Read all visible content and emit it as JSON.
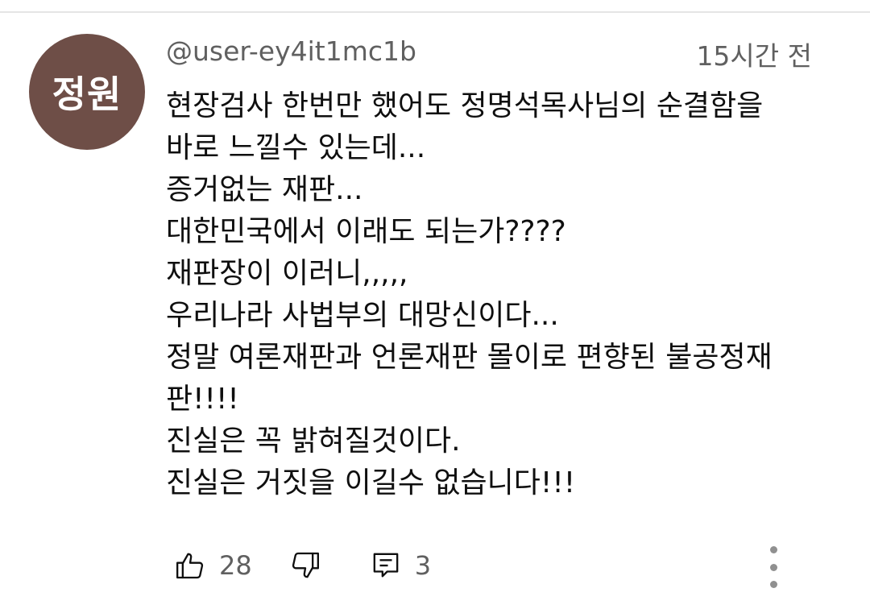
{
  "comment": {
    "avatar_text": "정원",
    "author": "@user-ey4it1mc1b",
    "timestamp": "15시간 전",
    "lines": [
      "현장검사 한번만 했어도 정명석목사님의 순결함을",
      "바로 느낄수 있는데...",
      "증거없는 재판...",
      "대한민국에서 이래도 되는가????",
      "재판장이 이러니,,,,,",
      "우리나라 사법부의 대망신이다...",
      "정말 여론재판과 언론재판 몰이로 편향된 불공정재",
      "판!!!!",
      "진실은 꼭 밝혀질것이다.",
      "진실은 거짓을 이길수 없습니다!!!"
    ],
    "like_count": "28",
    "reply_count": "3"
  },
  "icons": {
    "like": "thumbs-up-icon",
    "dislike": "thumbs-down-icon",
    "reply": "reply-comment-icon",
    "more": "vertical-dots-icon"
  },
  "colors": {
    "avatar_bg": "#6e4e47",
    "secondary_text": "#606060",
    "primary_text": "#0f0f0f"
  }
}
